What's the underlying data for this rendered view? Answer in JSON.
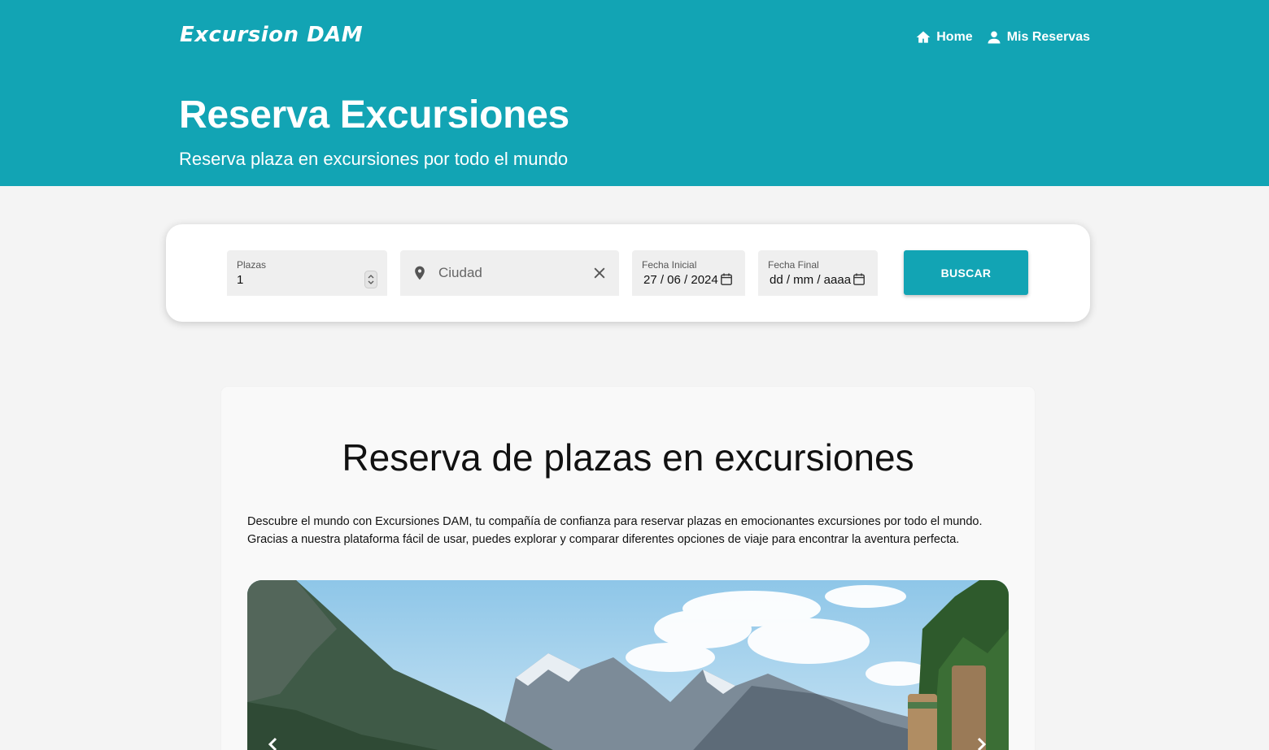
{
  "header": {
    "brand": "Excursion DAM",
    "nav": [
      {
        "label": "Home",
        "icon": "home-icon"
      },
      {
        "label": "Mis Reservas",
        "icon": "user-icon"
      }
    ],
    "title": "Reserva Excursiones",
    "subtitle": "Reserva plaza en excursiones por todo el mundo",
    "bg_color": "#12a4b4"
  },
  "search": {
    "plazas_label": "Plazas",
    "plazas_value": "1",
    "ciudad_placeholder": "Ciudad",
    "fecha_inicial_label": "Fecha Inicial",
    "fecha_inicial_value": "27 / 06 / 2024",
    "fecha_final_label": "Fecha Final",
    "fecha_final_value": "dd / mm / aaaa",
    "button_label": "BUSCAR",
    "accent_color": "#12a4b4"
  },
  "content": {
    "title": "Reserva de plazas en excursiones",
    "paragraph_lines": [
      "Descubre el mundo con Excursiones DAM, tu compañía de confianza para reservar plazas en emocionantes excursiones por todo el mundo.",
      "Gracias a nuestra plataforma fácil de usar, puedes explorar y comparar diferentes opciones de viaje para encontrar la aventura perfecta."
    ],
    "carousel": {
      "image": "mountain-landscape",
      "prev_icon": "chevron-left-icon",
      "next_icon": "chevron-right-icon"
    }
  }
}
